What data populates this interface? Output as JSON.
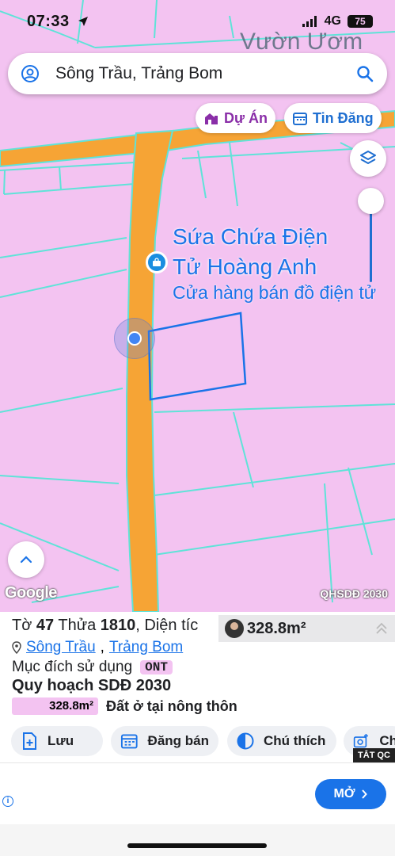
{
  "status": {
    "time": "07:33",
    "network": "4G",
    "battery": "75"
  },
  "search": {
    "query": "Sông Trầu, Trảng Bom"
  },
  "chips": {
    "du_an": "Dự Án",
    "tin_dang": "Tin Đăng"
  },
  "map": {
    "garden_label": "Vườn Ươm",
    "poi_name_line1": "Sứa Chứa Điện",
    "poi_name_line2": "Tử Hoàng Anh",
    "poi_category": "Cửa hàng bán đồ điện tử",
    "google": "Google",
    "layer_label": "QHSDĐ 2030",
    "colors": {
      "land": "#f3c3f1",
      "road": "#f6a435",
      "parcel_line": "#5fe3d8",
      "selection": "#1a73e8"
    }
  },
  "parcel": {
    "to_label": "Tờ",
    "to_value": "47",
    "thua_label": "Thửa",
    "thua_value": "1810",
    "area_label": "Diện tíc",
    "area_value": "328.8m²",
    "commune": "Sông Trầu",
    "district": "Trảng Bom",
    "purpose_label": "Mục đích sử dụng",
    "purpose_code": "ONT",
    "plan_title": "Quy hoạch SDĐ 2030",
    "plan_area": "328.8m²",
    "plan_desc": "Đất ở tại nông thôn"
  },
  "actions": {
    "save": "Lưu",
    "post": "Đăng bán",
    "legend": "Chú thích",
    "more": "Ch",
    "close_ad": "TẮT QC"
  },
  "ad": {
    "button": "MỞ"
  }
}
